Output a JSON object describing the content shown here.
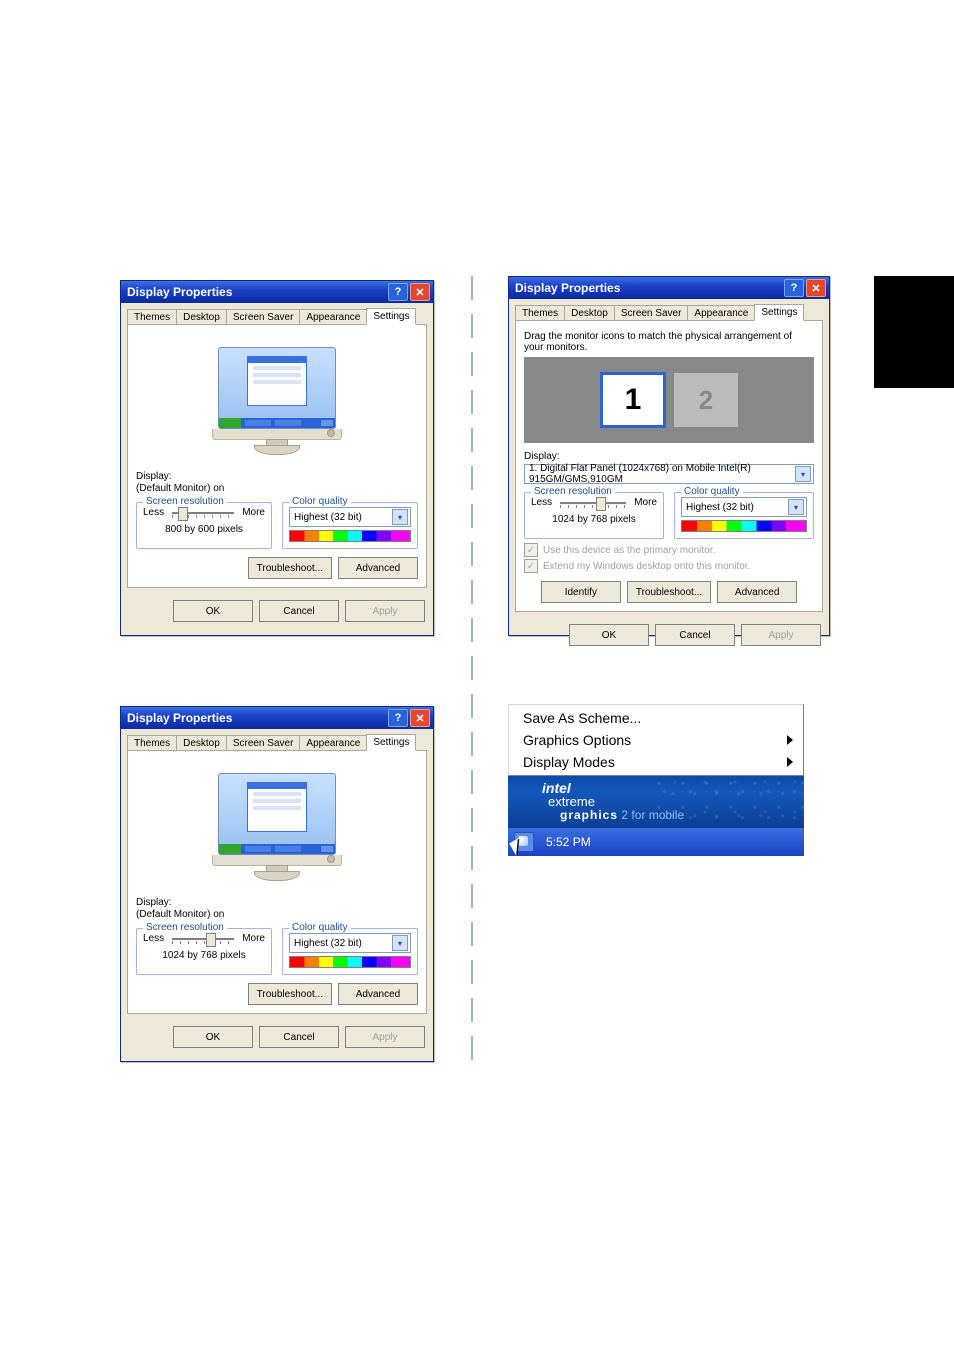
{
  "dialog": {
    "title": "Display Properties",
    "tabs": [
      "Themes",
      "Desktop",
      "Screen Saver",
      "Appearance",
      "Settings"
    ],
    "display_label": "Display:",
    "display_sub": "(Default Monitor) on",
    "screen_res_legend": "Screen resolution",
    "color_q_legend": "Color quality",
    "less": "Less",
    "more": "More",
    "res1": "800 by 600 pixels",
    "res2": "1024 by 768 pixels",
    "cq_value": "Highest (32 bit)",
    "troubleshoot": "Troubleshoot...",
    "advanced": "Advanced",
    "ok": "OK",
    "cancel": "Cancel",
    "apply": "Apply"
  },
  "dialog3": {
    "help_text": "Drag the monitor icons to match the physical arrangement of your monitors.",
    "mon1": "1",
    "mon2": "2",
    "display_value": "1. Digital Flat Panel (1024x768) on Mobile Intel(R) 915GM/GMS,910GM",
    "res": "1024 by 768 pixels",
    "chk1": "Use this device as the primary monitor.",
    "chk2": "Extend my Windows desktop onto this monitor.",
    "identify": "Identify"
  },
  "tray": {
    "menu": {
      "save_scheme": "Save As Scheme...",
      "graphics_options": "Graphics Options",
      "display_modes": "Display Modes"
    },
    "banner": {
      "line1": "intel",
      "line2": "extreme",
      "line3_bold": "graphics",
      "line3_rest": " 2 for mobile"
    },
    "clock": "5:52 PM"
  }
}
